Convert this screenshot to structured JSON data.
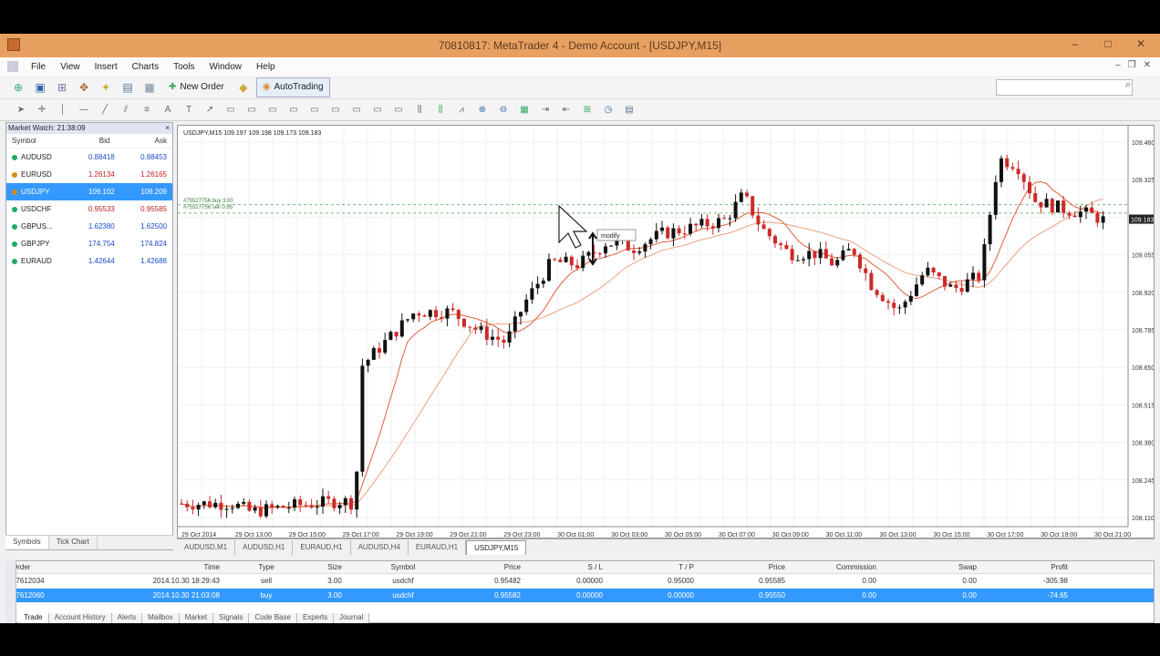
{
  "window": {
    "title": "70810817: MetaTrader 4 - Demo Account - [USDJPY,M15]",
    "controls": [
      "–",
      "□",
      "✕"
    ]
  },
  "menu": [
    "File",
    "View",
    "Insert",
    "Charts",
    "Tools",
    "Window",
    "Help"
  ],
  "toolbar": {
    "new_order": "New Order",
    "autotrading": "AutoTrading"
  },
  "market_watch": {
    "header": "Market Watch: 21:38:09",
    "close": "×",
    "col_symbol": "Symbol",
    "col_bid": "Bid",
    "col_ask": "Ask",
    "rows": [
      {
        "symbol": "AUDUSD",
        "bid": "0.88418",
        "ask": "0.88453",
        "color": "#2a6",
        "bid_color": "#1a4acc",
        "ask_color": "#1a4acc"
      },
      {
        "symbol": "EURUSD",
        "bid": "1.26134",
        "ask": "1.26165",
        "color": "#d58a20",
        "bid_color": "#c02020",
        "ask_color": "#c02020"
      },
      {
        "symbol": "USDJPY",
        "bid": "109.102",
        "ask": "109.209",
        "color": "#d58a20",
        "bid_color": "#ffffff",
        "ask_color": "#ffffff",
        "selected": true
      },
      {
        "symbol": "USDCHF",
        "bid": "0.95533",
        "ask": "0.95585",
        "color": "#2a6",
        "bid_color": "#c02020",
        "ask_color": "#c02020"
      },
      {
        "symbol": "GBPUS...",
        "bid": "1.62380",
        "ask": "1.62500",
        "color": "#2a6",
        "bid_color": "#1a4acc",
        "ask_color": "#1a4acc"
      },
      {
        "symbol": "GBPJPY",
        "bid": "174.754",
        "ask": "174.824",
        "color": "#2a6",
        "bid_color": "#1a4acc",
        "ask_color": "#1a4acc"
      },
      {
        "symbol": "EURAUD",
        "bid": "1.42644",
        "ask": "1.42688",
        "color": "#2a6",
        "bid_color": "#1a4acc",
        "ask_color": "#1a4acc"
      }
    ],
    "tabs": [
      "Symbols",
      "Tick Chart"
    ]
  },
  "chart": {
    "header": "USDJPY,M15 109.197 109.198 109.173 109.183",
    "ma_labels": [
      "#75527756 buy 3.00",
      "#75527756 sell 0.95"
    ],
    "tooltip": "modify",
    "current_price": "109.183",
    "y_ticks": [
      "109.460",
      "109.325",
      "109.190",
      "109.055",
      "108.920",
      "108.785",
      "108.650",
      "108.515",
      "108.380",
      "108.245",
      "108.110"
    ],
    "x_ticks": [
      "29 Oct 2014",
      "29 Oct 13:00",
      "29 Oct 15:00",
      "29 Oct 17:00",
      "29 Oct 19:00",
      "29 Oct 21:00",
      "29 Oct 23:00",
      "30 Oct 01:00",
      "30 Oct 03:00",
      "30 Oct 05:00",
      "30 Oct 07:00",
      "30 Oct 09:00",
      "30 Oct 11:00",
      "30 Oct 13:00",
      "30 Oct 15:00",
      "30 Oct 17:00",
      "30 Oct 19:00",
      "30 Oct 21:00"
    ],
    "tabs": [
      "AUDUSD,M1",
      "AUDUSD,H1",
      "EURAUD,H1",
      "AUDUSD,H4",
      "EURAUD,H1",
      "USDJPY,M15"
    ],
    "bull_color": "#111111",
    "bear_color": "#cc2a2a",
    "ma_fast_color": "#e0603a",
    "ma_slow_color": "#f0a080"
  },
  "terminal": {
    "headers": [
      "Order",
      "Time",
      "Type",
      "Size",
      "Symbol",
      "Price",
      "S / L",
      "T / P",
      "Price",
      "Commission",
      "Swap",
      "Profit"
    ],
    "rows": [
      [
        "57612034",
        "2014.10.30 18:29:43",
        "sell",
        "3.00",
        "usdchf",
        "0.95482",
        "0.00000",
        "0.95000",
        "0.95585",
        "0.00",
        "0.00",
        "-305.98"
      ],
      [
        "57612060",
        "2014.10.30 21:03:08",
        "buy",
        "3.00",
        "usdchf",
        "0.95582",
        "0.00000",
        "0.00000",
        "0.95550",
        "0.00",
        "0.00",
        "-74.65"
      ]
    ],
    "tabs": [
      "Trade",
      "Account History",
      "Alerts",
      "Mailbox",
      "Market",
      "Signals",
      "Code Base",
      "Experts",
      "Journal"
    ]
  }
}
